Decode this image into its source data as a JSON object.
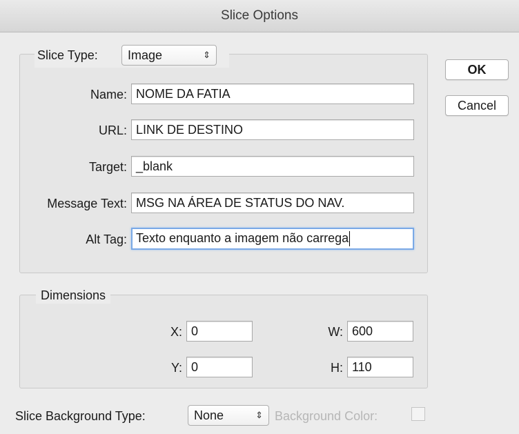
{
  "window": {
    "title": "Slice Options"
  },
  "buttons": {
    "ok": "OK",
    "cancel": "Cancel"
  },
  "slice": {
    "type_label": "Slice Type:",
    "type_value": "Image",
    "name_label": "Name:",
    "name_value": "NOME DA FATIA",
    "url_label": "URL:",
    "url_value": "LINK DE DESTINO",
    "target_label": "Target:",
    "target_value": "_blank",
    "message_label": "Message Text:",
    "message_value": "MSG NA ÁREA DE STATUS DO NAV.",
    "alt_label": "Alt Tag:",
    "alt_value": "Texto enquanto a imagem não carrega"
  },
  "dimensions": {
    "legend": "Dimensions",
    "x_label": "X:",
    "x_value": "0",
    "y_label": "Y:",
    "y_value": "0",
    "w_label": "W:",
    "w_value": "600",
    "h_label": "H:",
    "h_value": "110"
  },
  "background": {
    "type_label": "Slice Background Type:",
    "type_value": "None",
    "color_label": "Background Color:"
  },
  "icons": {
    "popup_arrows": "⇕"
  }
}
